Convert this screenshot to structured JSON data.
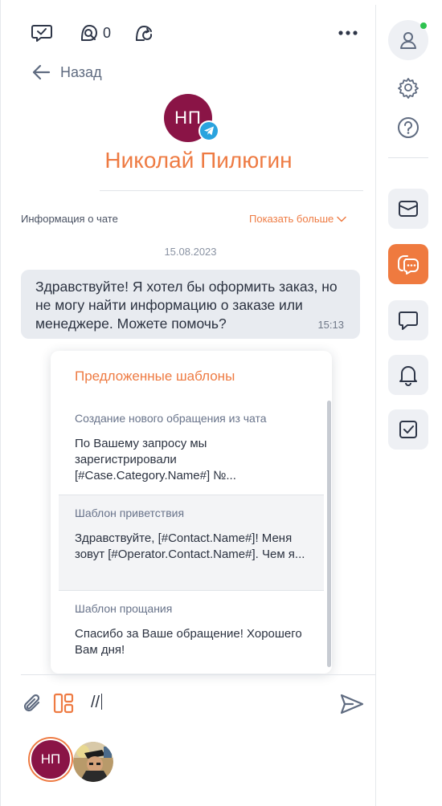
{
  "header": {
    "inquiry_count": "0",
    "back_label": "Назад"
  },
  "contact": {
    "initials": "НП",
    "name": "Николай Пилюгин",
    "channel_icon": "telegram-icon"
  },
  "chat_info": {
    "label": "Информация о чате",
    "show_more": "Показать больше"
  },
  "messages": {
    "date": "15.08.2023",
    "items": [
      {
        "text": "Здравствуйте! Я хотел бы оформить заказ, но не могу найти информацию о заказе или менеджере. Можете помочь?",
        "time": "15:13"
      }
    ]
  },
  "templates": {
    "title": "Предложенные шаблоны",
    "items": [
      {
        "title": "Создание нового обращения из чата",
        "body": "По Вашему запросу мы зарегистрировали [#Case.Category.Name#] №..."
      },
      {
        "title": "Шаблон приветствия",
        "body": "Здравствуйте, [#Contact.Name#]! Меня зовут [#Operator.Contact.Name#]. Чем я..."
      },
      {
        "title": "Шаблон прощания",
        "body": "Спасибо за Ваше обращение! Хорошего Вам дня!"
      }
    ]
  },
  "composer": {
    "value": "//"
  },
  "participants": {
    "items": [
      {
        "initials": "НП"
      }
    ]
  },
  "colors": {
    "accent": "#ef7a3f",
    "avatar": "#8a1446",
    "telegram": "#2aa3de",
    "online": "#2ec24f"
  },
  "sidebar": {
    "items": [
      "email-icon",
      "chat-icon",
      "message-icon",
      "bell-icon",
      "tasks-icon"
    ]
  }
}
